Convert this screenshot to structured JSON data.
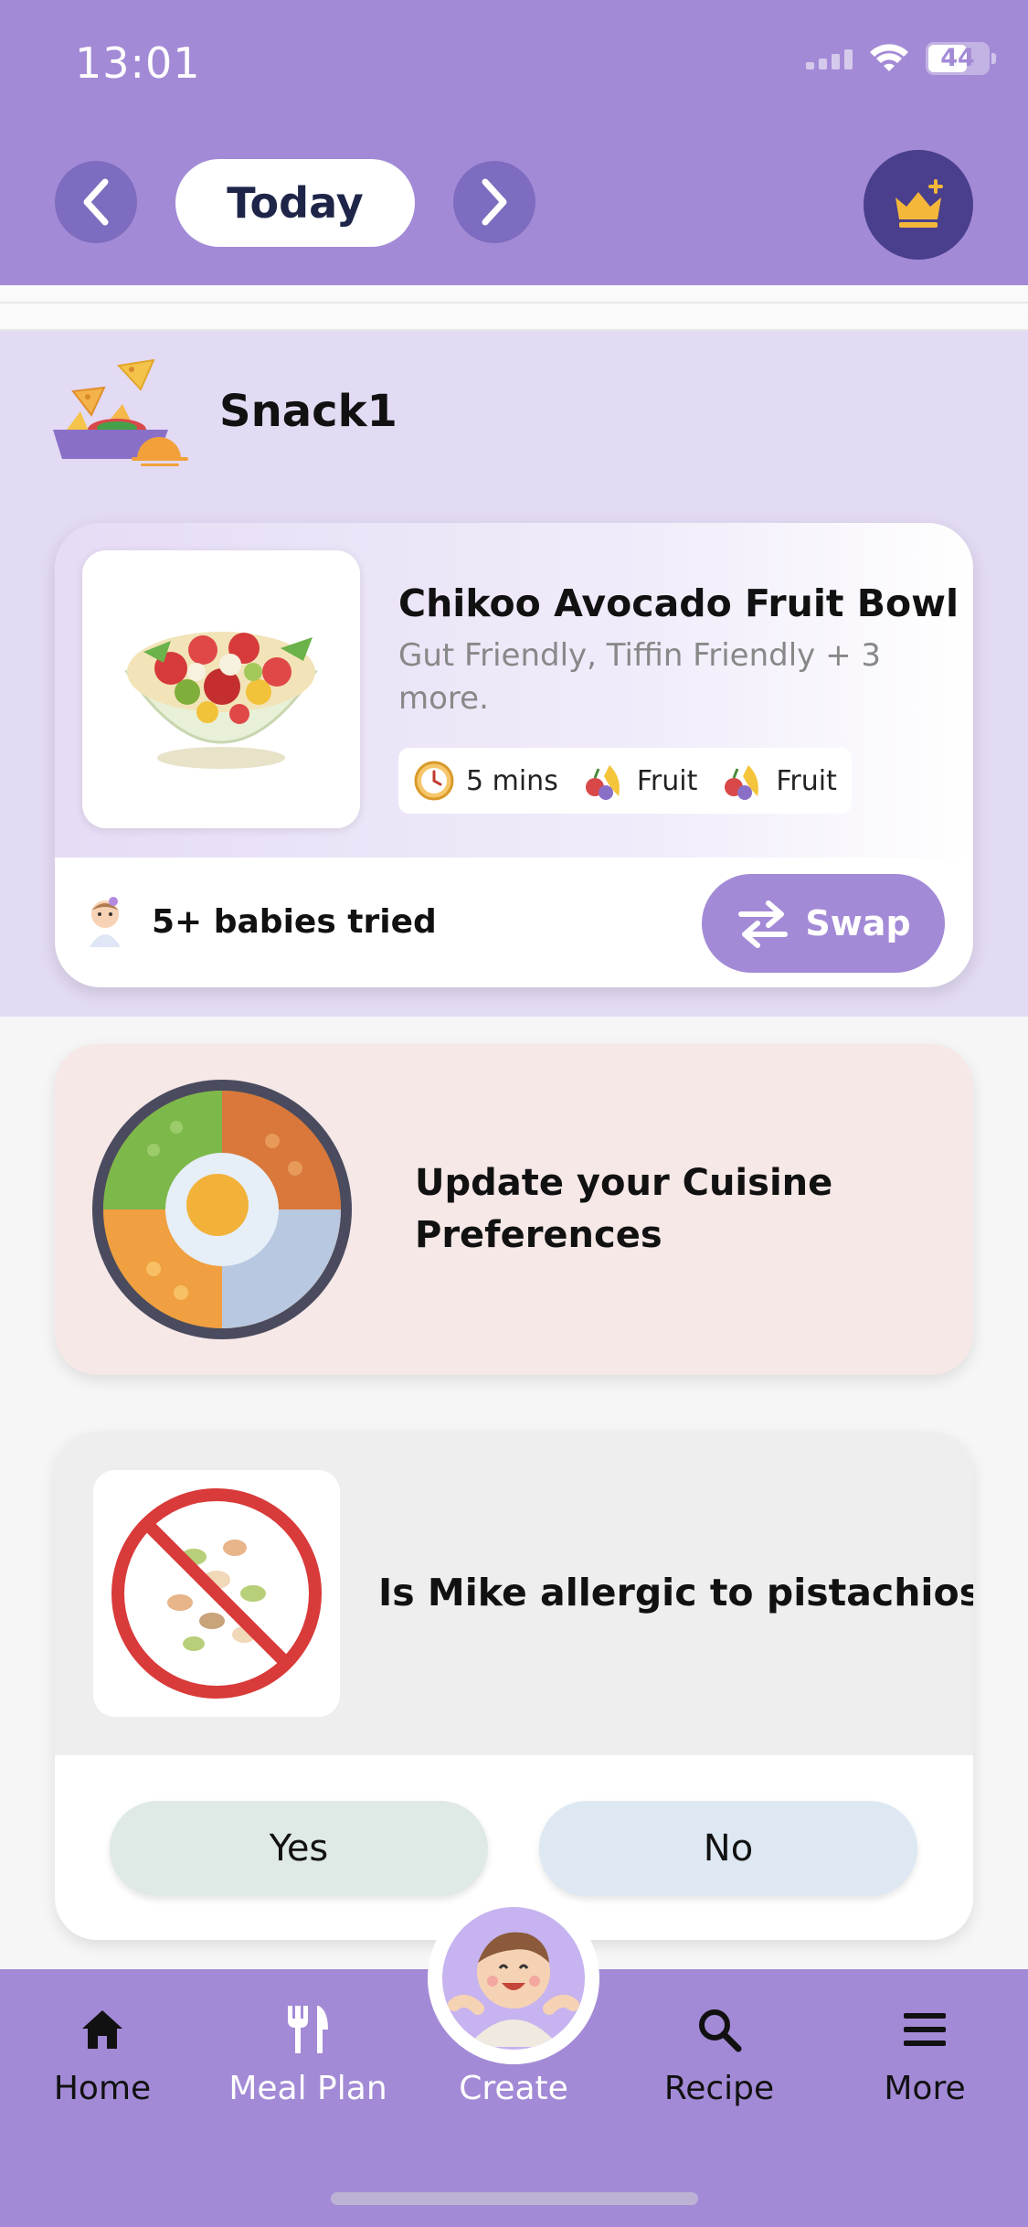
{
  "status_bar": {
    "time": "13:01",
    "battery": "44"
  },
  "header": {
    "date_label": "Today"
  },
  "meal": {
    "title": "Snack1",
    "recipe": {
      "name": "Chikoo Avocado Fruit Bowl",
      "tags": "Gut Friendly, Tiffin Friendly + 3 more.",
      "chips": [
        {
          "icon": "clock-icon",
          "label": "5 mins"
        },
        {
          "icon": "fruit-icon",
          "label": "Fruit"
        },
        {
          "icon": "fruit-icon",
          "label": "Fruit"
        }
      ],
      "tried_text": "5+ babies tried",
      "swap_label": "Swap"
    }
  },
  "cuisine_card": {
    "text": "Update your Cuisine Preferences"
  },
  "allergy_card": {
    "question": "Is Mike allergic to pistachios?",
    "yes_label": "Yes",
    "no_label": "No"
  },
  "tabs": [
    {
      "label": "Home",
      "icon": "home-icon"
    },
    {
      "label": "Meal Plan",
      "icon": "fork-knife-icon"
    },
    {
      "label": "Create",
      "icon": "baby-avatar-icon"
    },
    {
      "label": "Recipe",
      "icon": "search-icon"
    },
    {
      "label": "More",
      "icon": "menu-icon"
    }
  ],
  "colors": {
    "primary": "#a38ad6",
    "snack_bg": "#e3daf3",
    "crown_bg": "#4a3f8c",
    "cuisine_bg": "#f6e8e7",
    "allergy_bg": "#eeeeee"
  }
}
